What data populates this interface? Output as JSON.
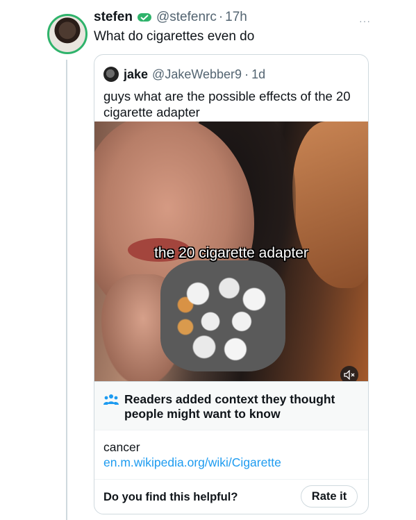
{
  "tweet": {
    "name": "stefen",
    "handle": "@stefenrc",
    "separator": "·",
    "time": "17h",
    "text": "What do cigarettes even do",
    "more": "···"
  },
  "quote": {
    "name": "jake",
    "handle": "@JakeWebber9",
    "separator": "·",
    "time": "1d",
    "text": "guys what are the possible effects of the 20 cigarette adapter",
    "media_caption": "the 20 cigarette adapter"
  },
  "community_note": {
    "title": "Readers added context they thought people might want to know",
    "body": "cancer",
    "link": "en.m.wikipedia.org/wiki/Cigarette",
    "question": "Do you find this helpful?",
    "rate_label": "Rate it"
  },
  "colors": {
    "link": "#1d9bf0",
    "badge": "#2fb36b",
    "muted": "#536471"
  },
  "icons": [
    "more-icon",
    "verified-badge-icon",
    "mute-icon",
    "people-icon"
  ]
}
